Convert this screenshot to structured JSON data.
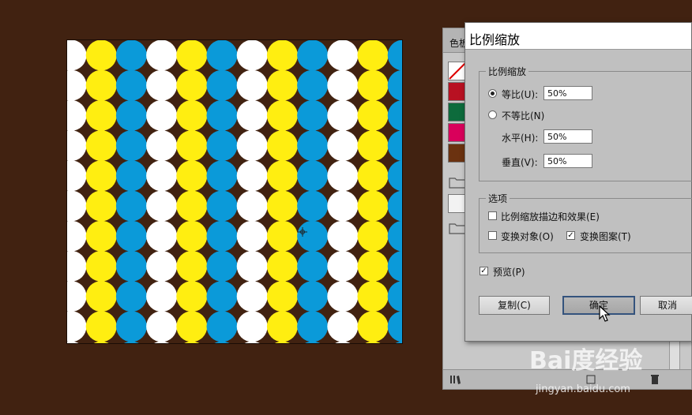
{
  "colors": {
    "background": "#412211",
    "white": "#ffffff",
    "yellow": "#ffee11",
    "blue": "#0b9ad9",
    "dialog_bg": "#c0c0c0"
  },
  "artboard": {
    "pattern_columns": [
      "white",
      "yellow",
      "blue",
      "white",
      "yellow",
      "blue",
      "white",
      "yellow",
      "blue",
      "white",
      "yellow",
      "blue"
    ]
  },
  "swatches_panel": {
    "tab_label": "色板",
    "swatches": [
      "none",
      "#b81122",
      "#0d6b3c",
      "#d9005b",
      "#6b3210"
    ],
    "footer_icon": "library-icon"
  },
  "dialog": {
    "title": "比例缩放",
    "scale_group": {
      "legend": "比例缩放",
      "uniform_label": "等比(U):",
      "uniform_value": "50%",
      "uniform_selected": true,
      "non_uniform_label": "不等比(N)",
      "horizontal_label": "水平(H):",
      "horizontal_value": "50%",
      "vertical_label": "垂直(V):",
      "vertical_value": "50%"
    },
    "options_group": {
      "legend": "选项",
      "scale_strokes_label": "比例缩放描边和效果(E)",
      "scale_strokes_checked": false,
      "transform_objects_label": "变换对象(O)",
      "transform_objects_checked": false,
      "transform_patterns_label": "变换图案(T)",
      "transform_patterns_checked": true
    },
    "preview_label": "预览(P)",
    "preview_checked": true,
    "buttons": {
      "copy": "复制(C)",
      "ok": "确定",
      "cancel": "取消"
    }
  },
  "watermark": {
    "text": "Bai度经验",
    "url": "jingyan.baidu.com"
  }
}
